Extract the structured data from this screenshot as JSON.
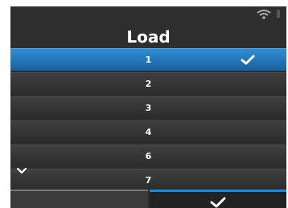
{
  "screen": {
    "title": "Load",
    "status_icons": [
      "wifi-icon",
      "battery-icon"
    ]
  },
  "list": {
    "items": [
      {
        "label": "1",
        "selected": true
      },
      {
        "label": "2",
        "selected": false
      },
      {
        "label": "3",
        "selected": false
      },
      {
        "label": "4",
        "selected": false
      },
      {
        "label": "6",
        "selected": false
      },
      {
        "label": "7",
        "selected": false
      }
    ]
  },
  "footer": {
    "left_button": "",
    "right_button_icon": "checkmark-icon"
  },
  "colors": {
    "accent": "#1e88d8",
    "background": "#2e2e2e",
    "text": "#ffffff"
  }
}
